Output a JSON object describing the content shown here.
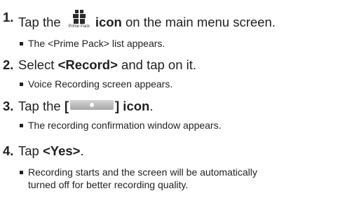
{
  "steps": [
    {
      "number": "1.",
      "text_before": "Tap the ",
      "icon_name": "prime-pack-icon",
      "icon_label": "Prime Pack",
      "bold": "icon",
      "text_after": " on the main menu screen.",
      "notes": [
        "The <Prime Pack> list appears."
      ]
    },
    {
      "number": "2.",
      "text_before": "Select ",
      "bold": "<Record>",
      "text_after": " and tap on it.",
      "notes": [
        "Voice Recording screen appears."
      ]
    },
    {
      "number": "3.",
      "text_before": "Tap the ",
      "bracket_open": "[",
      "icon_name": "record-button-icon",
      "bracket_close_bold": "] icon",
      "text_after": ".",
      "notes": [
        "The recording confirmation window appears."
      ]
    },
    {
      "number": "4.",
      "text_before": "Tap ",
      "bold": "<Yes>",
      "text_after": ".",
      "notes": [
        "Recording starts and the screen will be automatically",
        "turned off for better recording quality."
      ]
    }
  ]
}
